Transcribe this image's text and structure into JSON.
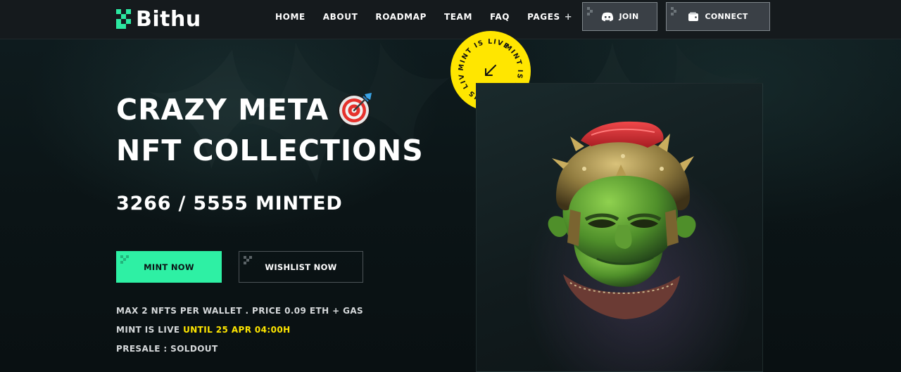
{
  "brand": {
    "name": "Bithu",
    "accent": "#2ef0a4",
    "highlight": "#ffe600"
  },
  "nav": {
    "items": [
      "HOME",
      "ABOUT",
      "ROADMAP",
      "TEAM",
      "FAQ",
      "PAGES"
    ],
    "pages_expand_icon": "plus-icon"
  },
  "header_buttons": {
    "join": {
      "label": "JOIN",
      "icon": "discord-icon"
    },
    "connect": {
      "label": "CONNECT",
      "icon": "wallet-icon"
    }
  },
  "badge": {
    "text": "MINT IS LIVE",
    "icon": "arrow-down-left-icon"
  },
  "hero": {
    "title_line1": "CRAZY META",
    "title_icon": "target-dart-icon",
    "title_line2": "NFT COLLECTIONS",
    "minted": "3266 / 5555 MINTED",
    "mint_button": "MINT NOW",
    "wishlist_button": "WISHLIST NOW",
    "info_line1": "MAX 2 NFTS PER WALLET . PRICE 0.09 ETH + GAS",
    "info_line2_prefix": "MINT IS LIVE ",
    "info_line2_highlight": "UNTIL 25 APR 04:00H",
    "info_line3": "PRESALE : SOLDOUT"
  },
  "art": {
    "subject": "nft-character-art"
  }
}
